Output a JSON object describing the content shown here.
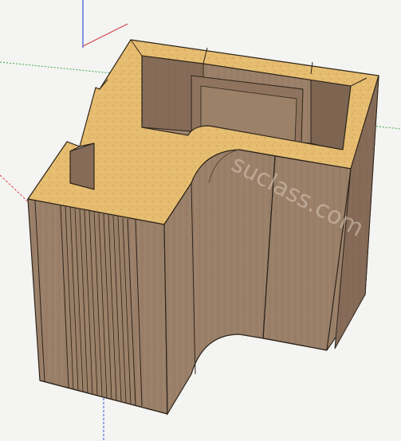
{
  "viewport": {
    "background": "#f4f4f2",
    "axes": {
      "red_axis_color": "#d24a4a",
      "green_axis_color": "#3fa84a",
      "blue_axis_color": "#3a55d8"
    }
  },
  "model": {
    "wood_color": "#9c826a",
    "wood_dark": "#7a6250",
    "wood_light": "#b49a82",
    "top_edge_color": "#e8bf73",
    "edge_line_color": "#2e241c"
  },
  "watermark": {
    "text": "suclass.com",
    "color": "#c8b8a8"
  }
}
